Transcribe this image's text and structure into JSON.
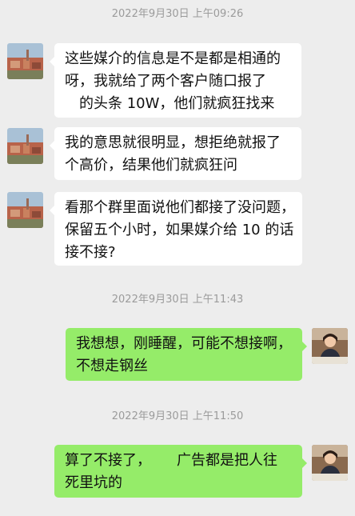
{
  "chat": {
    "timestamps": [
      "2022年9月30日 上午09:26",
      "2022年9月30日 上午11:43",
      "2022年9月30日 上午11:50"
    ],
    "messages": [
      {
        "sender": "contact",
        "lines": [
          "这些媒介的信息是不是都是相通的",
          "呀，我就给了两个客户随口报了",
          "的头条 10W，他们就疯狂找来"
        ]
      },
      {
        "sender": "contact",
        "lines": [
          "我的意思就很明显，想拒绝就报了",
          "个高价，结果他们就疯狂问"
        ]
      },
      {
        "sender": "contact",
        "lines": [
          "看那个群里面说他们都接了没问题，",
          "保留五个小时，如果媒介给 10 的话",
          "接不接?"
        ]
      },
      {
        "sender": "me",
        "lines": [
          "我想想，刚睡醒，可能不想接啊，",
          "不想走钢丝"
        ]
      },
      {
        "sender": "me",
        "lines": [
          "算了不接了，",
          "广告都是把人往",
          "死里坑的"
        ]
      }
    ]
  },
  "icons": {
    "contact_avatar": "contact-avatar-town-photo",
    "my_avatar": "user-avatar-portrait-photo"
  },
  "colors": {
    "background": "#ededed",
    "incoming_bubble": "#ffffff",
    "outgoing_bubble": "#95ec69",
    "timestamp": "#9b9b9b"
  }
}
